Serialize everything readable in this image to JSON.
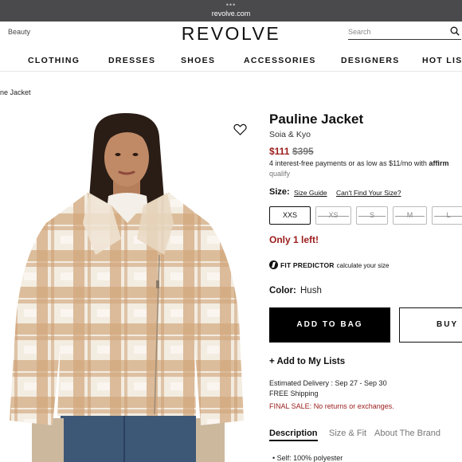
{
  "browser": {
    "dots": "•••",
    "url": "revolve.com"
  },
  "header": {
    "beauty_link": "Beauty",
    "logo": "REVOLVE",
    "search_placeholder": "Search"
  },
  "nav": {
    "items": [
      "CLOTHING",
      "DRESSES",
      "SHOES",
      "ACCESSORIES",
      "DESIGNERS",
      "HOT LIST"
    ]
  },
  "breadcrumb": "ne Jacket",
  "product": {
    "title": "Pauline Jacket",
    "brand": "Soia & Kyo",
    "sale_price": "$111",
    "original_price": "$395",
    "affirm_text": "4 interest-free payments or as low as $11/mo with",
    "affirm_logo": "affirm",
    "affirm_qualify": "qualify",
    "size_label": "Size:",
    "size_guide": "Size Guide",
    "cant_find_size": "Can't Find Your Size?",
    "sizes": [
      {
        "label": "XXS",
        "available": true,
        "selected": true
      },
      {
        "label": "XS",
        "available": false
      },
      {
        "label": "S",
        "available": false
      },
      {
        "label": "M",
        "available": false
      },
      {
        "label": "L",
        "available": false
      }
    ],
    "stock_message": "Only 1 left!",
    "fit_predictor_label": "FIT PREDICTOR",
    "fit_predictor_text": "calculate your size",
    "color_label": "Color:",
    "color_value": "Hush",
    "add_to_bag": "ADD TO BAG",
    "buy_now": "BUY NOW",
    "add_to_lists": "+ Add to My Lists",
    "delivery": "Estimated Delivery : Sep 27 - Sep 30",
    "shipping": "FREE Shipping",
    "final_sale": "FINAL SALE: No returns or exchanges.",
    "tabs": [
      "Description",
      "Size & Fit",
      "About The Brand"
    ],
    "description_bullets": [
      "Self: 100% polyester"
    ]
  },
  "colors": {
    "sale_red": "#9b1b1b",
    "button_black": "#000000",
    "chrome_gray": "#4a4a4c"
  }
}
